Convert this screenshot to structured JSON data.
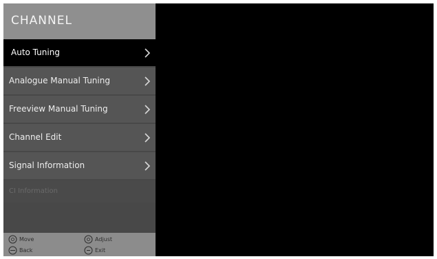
{
  "menu": {
    "title": "CHANNEL",
    "items": [
      {
        "label": "Auto Tuning",
        "selected": true
      },
      {
        "label": "Analogue Manual Tuning",
        "selected": false
      },
      {
        "label": "Freeview Manual Tuning",
        "selected": false
      },
      {
        "label": "Channel Edit",
        "selected": false
      },
      {
        "label": "Signal Information",
        "selected": false
      }
    ],
    "disabled_item": "CI Information"
  },
  "footer": {
    "move": "Move",
    "back": "Back",
    "adjust": "Adjust",
    "exit": "Exit"
  },
  "colors": {
    "background": "#000000",
    "header": "#8f8f8f",
    "panel": "#484848",
    "item": "#555555",
    "selected": "#000000",
    "footer": "#8c8c8c"
  },
  "icons": {
    "chevron": "chevron-right-icon",
    "move": "dpad-icon",
    "back": "back-button-icon",
    "adjust": "dpad-adjust-icon",
    "exit": "exit-button-icon"
  }
}
